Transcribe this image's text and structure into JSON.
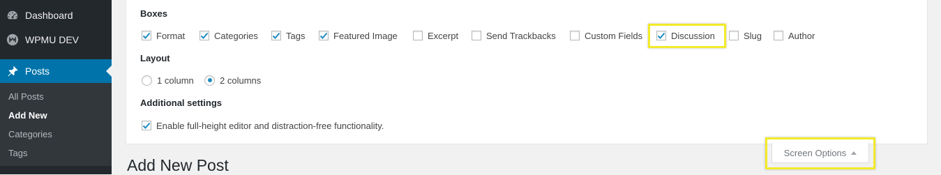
{
  "sidebar": {
    "top_items": [
      {
        "label": "Dashboard",
        "icon": "dashboard-icon"
      },
      {
        "label": "WPMU DEV",
        "icon": "wpmudev-icon"
      },
      {
        "label": "Posts",
        "icon": "pin-icon",
        "current": true
      }
    ],
    "submenu": [
      {
        "label": "All Posts"
      },
      {
        "label": "Add New",
        "active": true
      },
      {
        "label": "Categories"
      },
      {
        "label": "Tags"
      }
    ]
  },
  "screen_options": {
    "boxes_title": "Boxes",
    "boxes": [
      {
        "label": "Format",
        "checked": true
      },
      {
        "label": "Categories",
        "checked": true
      },
      {
        "label": "Tags",
        "checked": true
      },
      {
        "label": "Featured Image",
        "checked": true
      },
      {
        "label": "Excerpt",
        "checked": false
      },
      {
        "label": "Send Trackbacks",
        "checked": false
      },
      {
        "label": "Custom Fields",
        "checked": false
      },
      {
        "label": "Discussion",
        "checked": true
      },
      {
        "label": "Slug",
        "checked": false
      },
      {
        "label": "Author",
        "checked": false
      }
    ],
    "layout_title": "Layout",
    "layout": [
      {
        "label": "1 column",
        "selected": false
      },
      {
        "label": "2 columns",
        "selected": true
      }
    ],
    "additional_title": "Additional settings",
    "additional": [
      {
        "label": "Enable full-height editor and distraction-free functionality.",
        "checked": true
      }
    ],
    "tab_label": "Screen Options"
  },
  "page": {
    "title": "Add New Post"
  },
  "colors": {
    "accent": "#0073aa",
    "highlight": "#f2ea2a",
    "check": "#1e8cbe"
  }
}
